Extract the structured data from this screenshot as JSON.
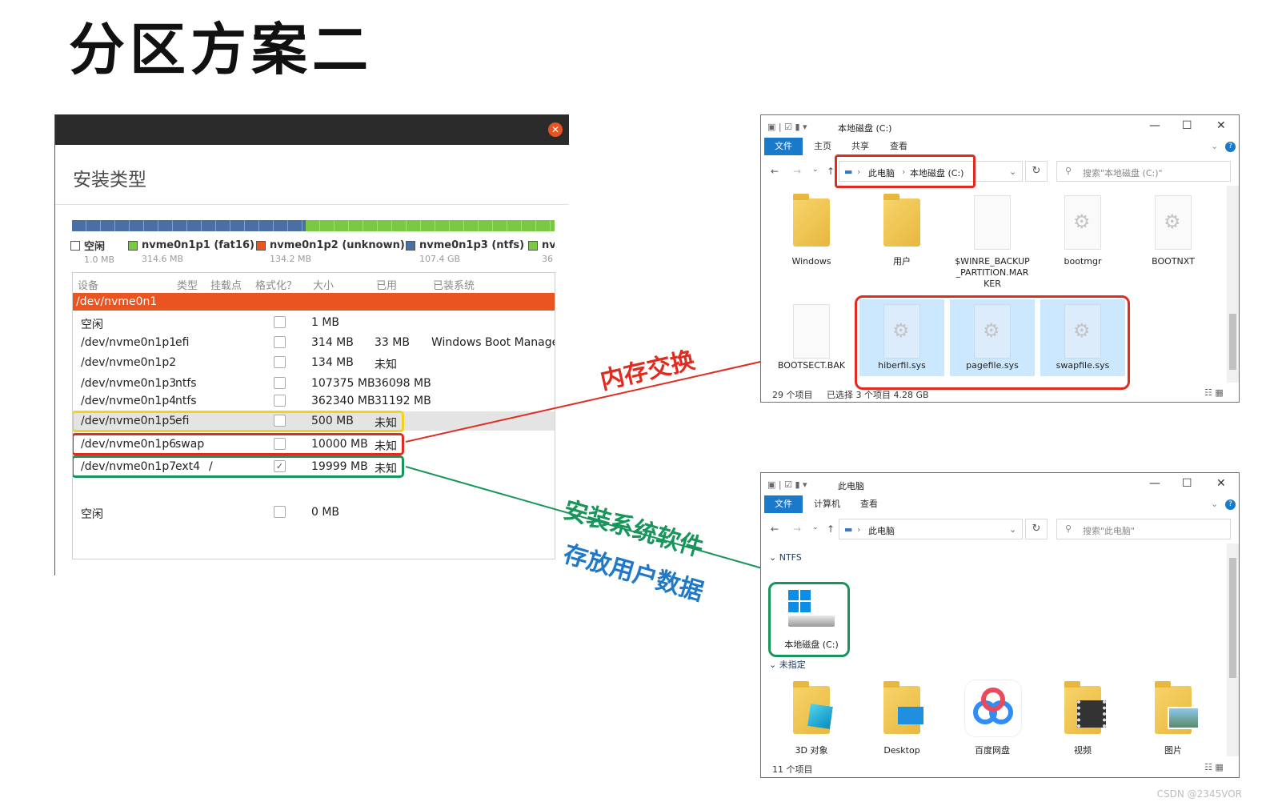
{
  "slide": {
    "title": "分区方案二",
    "watermark_top": "",
    "watermark_bottom": "CSDN @2345VOR"
  },
  "installer": {
    "heading": "安装类型",
    "bar_segments": [
      {
        "label": "空闲",
        "color": "#4a6fa5",
        "share": 0.44
      },
      {
        "label": "nvme0n1p3 (ntfs)",
        "color": "#7ac943",
        "share": 0.56
      }
    ],
    "legend": [
      {
        "name": "空闲",
        "size": "1.0 MB",
        "color": "#ffffff"
      },
      {
        "name": "nvme0n1p1 (fat16)",
        "size": "314.6 MB",
        "color": "#7ac943"
      },
      {
        "name": "nvme0n1p2 (unknown)",
        "size": "134.2 MB",
        "color": "#e95420"
      },
      {
        "name": "nvme0n1p3 (ntfs)",
        "size": "107.4 GB",
        "color": "#4a6fa5"
      },
      {
        "name": "nv",
        "size": "36",
        "color": "#7ac943"
      }
    ],
    "columns": [
      "设备",
      "类型",
      "挂载点",
      "格式化？",
      "大小",
      "已用",
      "已装系统"
    ],
    "device_row": "/dev/nvme0n1",
    "rows": [
      {
        "device": "空闲",
        "type": "",
        "mount": "",
        "format": false,
        "size": "1 MB",
        "used": "",
        "system": ""
      },
      {
        "device": "/dev/nvme0n1p1",
        "type": "efi",
        "mount": "",
        "format": false,
        "size": "314 MB",
        "used": "33 MB",
        "system": "Windows Boot Manager"
      },
      {
        "device": "/dev/nvme0n1p2",
        "type": "",
        "mount": "",
        "format": false,
        "size": "134 MB",
        "used": "未知",
        "system": ""
      },
      {
        "device": "/dev/nvme0n1p3",
        "type": "ntfs",
        "mount": "",
        "format": false,
        "size": "107375 MB",
        "used": "36098 MB",
        "system": ""
      },
      {
        "device": "/dev/nvme0n1p4",
        "type": "ntfs",
        "mount": "",
        "format": false,
        "size": "362340 MB",
        "used": "31192 MB",
        "system": ""
      },
      {
        "device": "/dev/nvme0n1p5",
        "type": "efi",
        "mount": "",
        "format": false,
        "size": "500 MB",
        "used": "未知",
        "system": ""
      },
      {
        "device": "/dev/nvme0n1p6",
        "type": "swap",
        "mount": "",
        "format": false,
        "size": "10000 MB",
        "used": "未知",
        "system": ""
      },
      {
        "device": "/dev/nvme0n1p7",
        "type": "ext4",
        "mount": "/",
        "format": true,
        "size": "19999 MB",
        "used": "未知",
        "system": ""
      },
      {
        "device": "空闲",
        "type": "",
        "mount": "",
        "format": false,
        "size": "0 MB",
        "used": "",
        "system": ""
      }
    ]
  },
  "annotations": {
    "swap": "内存交换",
    "system_software": "安装系统软件",
    "user_data": "存放用户数据",
    "colors": {
      "red": "#e02b20",
      "green": "#17955a",
      "blue": "#1f78c8",
      "yellow": "#f2d21b"
    }
  },
  "explorer_c": {
    "title": "本地磁盘 (C:)",
    "tabs": [
      "文件",
      "主页",
      "共享",
      "查看"
    ],
    "breadcrumb": [
      "此电脑",
      "本地磁盘 (C:)"
    ],
    "search_placeholder": "搜索\"本地磁盘 (C:)\"",
    "items": [
      {
        "name": "Windows",
        "kind": "folder-docs",
        "selected": false
      },
      {
        "name": "用户",
        "kind": "folder-docs",
        "selected": false
      },
      {
        "name": "$WINRE_BACKUP_PARTITION.MARKER",
        "kind": "file",
        "selected": false
      },
      {
        "name": "bootmgr",
        "kind": "sysfile",
        "selected": false
      },
      {
        "name": "BOOTNXT",
        "kind": "sysfile",
        "selected": false
      },
      {
        "name": "BOOTSECT.BAK",
        "kind": "file",
        "selected": false
      },
      {
        "name": "hiberfil.sys",
        "kind": "sysfile",
        "selected": true
      },
      {
        "name": "pagefile.sys",
        "kind": "sysfile",
        "selected": true
      },
      {
        "name": "swapfile.sys",
        "kind": "sysfile",
        "selected": true
      }
    ],
    "status_count": "29 个项目",
    "status_selected": "已选择 3 个项目  4.28 GB"
  },
  "explorer_pc": {
    "title": "此电脑",
    "tabs": [
      "文件",
      "计算机",
      "查看"
    ],
    "breadcrumb": [
      "此电脑"
    ],
    "search_placeholder": "搜索\"此电脑\"",
    "group_ntfs": "NTFS",
    "drive": "本地磁盘 (C:)",
    "group_unassigned": "未指定",
    "folders": [
      "3D 对象",
      "Desktop",
      "百度网盘",
      "视频",
      "图片"
    ],
    "status_count": "11 个项目"
  }
}
